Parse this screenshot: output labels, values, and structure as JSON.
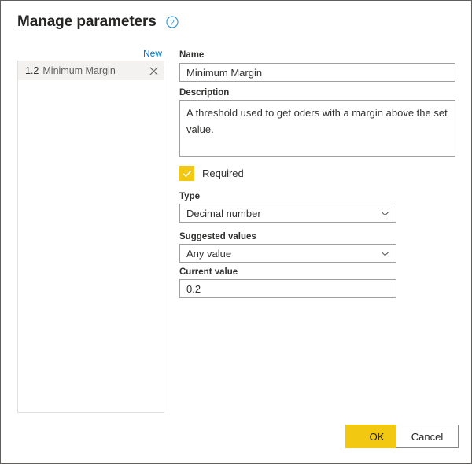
{
  "dialog": {
    "title": "Manage parameters",
    "help_icon": "help-circle-icon"
  },
  "left_panel": {
    "new_label": "New",
    "parameters": [
      {
        "type_badge": "1.2",
        "name": "Minimum Margin",
        "remove_icon": "close-icon"
      }
    ]
  },
  "form": {
    "name": {
      "label": "Name",
      "value": "Minimum Margin",
      "placeholder": ""
    },
    "description": {
      "label": "Description",
      "value": "A threshold used to get oders with a margin above the set value.",
      "placeholder": ""
    },
    "required": {
      "label": "Required",
      "checked": true,
      "check_icon": "checkmark-icon"
    },
    "type": {
      "label": "Type",
      "value": "Decimal number",
      "chevron_icon": "chevron-down-icon"
    },
    "suggested_values": {
      "label": "Suggested values",
      "value": "Any value",
      "chevron_icon": "chevron-down-icon"
    },
    "current_value": {
      "label": "Current value",
      "value": "0.2",
      "placeholder": ""
    }
  },
  "footer": {
    "ok_label": "OK",
    "cancel_label": "Cancel"
  },
  "colors": {
    "accent_yellow": "#f2c811",
    "link_blue": "#0078d4",
    "text_primary": "#252423",
    "text_secondary": "#605e5c",
    "border": "#a19f9d",
    "selected_row": "#f3f2f1"
  }
}
